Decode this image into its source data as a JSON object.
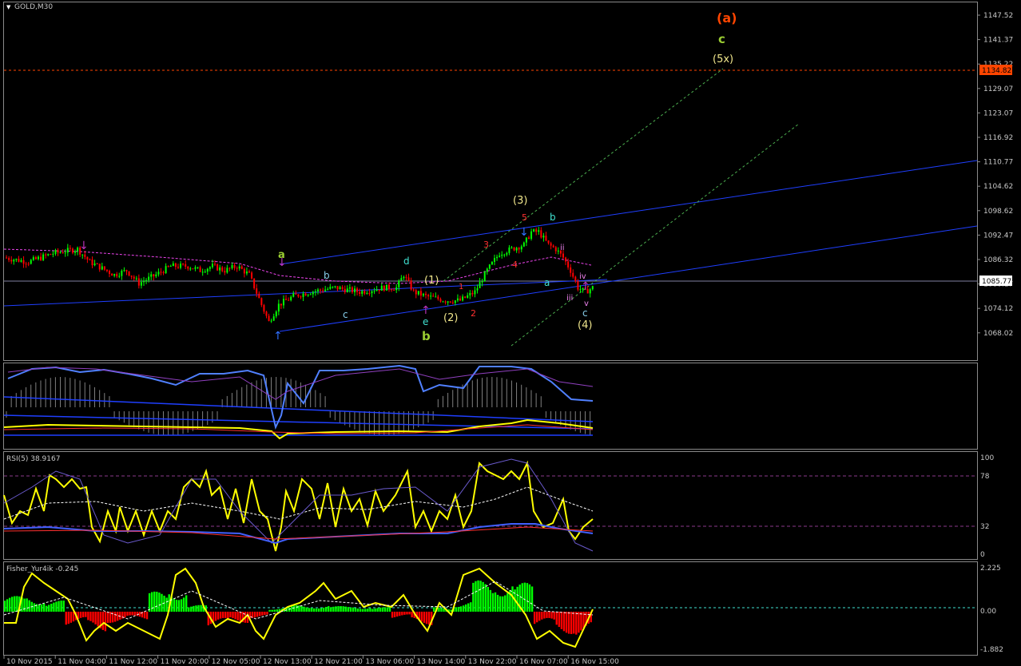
{
  "window_title": "GOLD,M30",
  "panels": {
    "main": {
      "current_price": "1085.77",
      "target_price": "1134.82",
      "y_ticks": [
        "1147.52",
        "1141.37",
        "1135.22",
        "1129.07",
        "1123.07",
        "1116.92",
        "1110.77",
        "1104.62",
        "1098.62",
        "1092.47",
        "1086.32",
        "1080.17",
        "1074.12",
        "1068.02"
      ]
    },
    "rsi": {
      "label": "RSI(5) 38.9167",
      "y_ticks": [
        "100",
        "78",
        "32",
        "0"
      ]
    },
    "fisher": {
      "label": "Fisher_Yur4ik -0.245",
      "y_ticks": [
        "2.225",
        "0.00",
        "-1.882"
      ]
    }
  },
  "time_axis": [
    "10 Nov 2015",
    "11 Nov 04:00",
    "11 Nov 12:00",
    "11 Nov 20:00",
    "12 Nov 05:00",
    "12 Nov 13:00",
    "12 Nov 21:00",
    "13 Nov 06:00",
    "13 Nov 14:00",
    "13 Nov 22:00",
    "16 Nov 07:00",
    "16 Nov 15:00"
  ],
  "wave_labels": [
    {
      "text": "(a)",
      "color": "#ff4500"
    },
    {
      "text": "c",
      "color": "#9acd32"
    },
    {
      "text": "(5x)",
      "color": "#f0e68c"
    },
    {
      "text": "(3)",
      "color": "#f0e68c"
    },
    {
      "text": "5",
      "color": "#ff3030"
    },
    {
      "text": "3",
      "color": "#ff3030"
    },
    {
      "text": "4",
      "color": "#ff3030"
    },
    {
      "text": "a",
      "color": "#9acd32"
    },
    {
      "text": "b",
      "color": "#87ceeb"
    },
    {
      "text": "c",
      "color": "#87ceeb"
    },
    {
      "text": "d",
      "color": "#40e0d0"
    },
    {
      "text": "(1)",
      "color": "#f0e68c"
    },
    {
      "text": "1",
      "color": "#ff3030"
    },
    {
      "text": "e",
      "color": "#40e0d0"
    },
    {
      "text": "b",
      "color": "#9acd32"
    },
    {
      "text": "(2)",
      "color": "#f0e68c"
    },
    {
      "text": "2",
      "color": "#ff3030"
    },
    {
      "text": "b",
      "color": "#40e0d0"
    },
    {
      "text": "a",
      "color": "#40e0d0"
    },
    {
      "text": "ii",
      "color": "#ee82ee"
    },
    {
      "text": "iii",
      "color": "#ee82ee"
    },
    {
      "text": "iv",
      "color": "#ee82ee"
    },
    {
      "text": "v",
      "color": "#ee82ee"
    },
    {
      "text": "c",
      "color": "#87ceeb"
    },
    {
      "text": "(4)",
      "color": "#f0e68c"
    }
  ],
  "colors": {
    "background": "#000000",
    "bull_candle": "#00ff00",
    "bear_candle": "#ff0000",
    "channel_line": "#1f3fff",
    "projection_line": "#4caf50",
    "target_line": "#ff4500",
    "rsi_line": "#ffff00",
    "fisher_pos": "#00ff00",
    "fisher_neg": "#ff0000"
  },
  "chart_data": {
    "type": "candlestick",
    "symbol": "GOLD",
    "timeframe": "M30",
    "ylim": [
      1068.02,
      1150
    ],
    "current_price": 1085.77,
    "target_price": 1134.82,
    "price_path": [
      [
        0,
        1091
      ],
      [
        10,
        1090
      ],
      [
        20,
        1092
      ],
      [
        30,
        1093
      ],
      [
        35,
        1090
      ],
      [
        45,
        1087
      ],
      [
        50,
        1088
      ],
      [
        55,
        1085
      ],
      [
        62,
        1087
      ],
      [
        68,
        1089
      ],
      [
        75,
        1089
      ],
      [
        80,
        1088
      ],
      [
        85,
        1089
      ],
      [
        90,
        1088
      ],
      [
        95,
        1089
      ],
      [
        100,
        1087
      ],
      [
        105,
        1080
      ],
      [
        108,
        1076
      ],
      [
        112,
        1080
      ],
      [
        118,
        1082
      ],
      [
        125,
        1083
      ],
      [
        135,
        1084
      ],
      [
        145,
        1083
      ],
      [
        155,
        1084
      ],
      [
        160,
        1084
      ],
      [
        163,
        1087
      ],
      [
        167,
        1083
      ],
      [
        172,
        1082
      ],
      [
        180,
        1081
      ],
      [
        186,
        1081
      ],
      [
        192,
        1083
      ],
      [
        197,
        1088
      ],
      [
        202,
        1092
      ],
      [
        207,
        1093
      ],
      [
        212,
        1094
      ],
      [
        215,
        1097
      ],
      [
        218,
        1097
      ],
      [
        222,
        1094
      ],
      [
        225,
        1093
      ],
      [
        228,
        1091
      ],
      [
        231,
        1088
      ],
      [
        234,
        1084
      ],
      [
        237,
        1083
      ],
      [
        240,
        1084
      ]
    ],
    "rsi_value": 38.9167,
    "fisher_value": -0.245
  }
}
